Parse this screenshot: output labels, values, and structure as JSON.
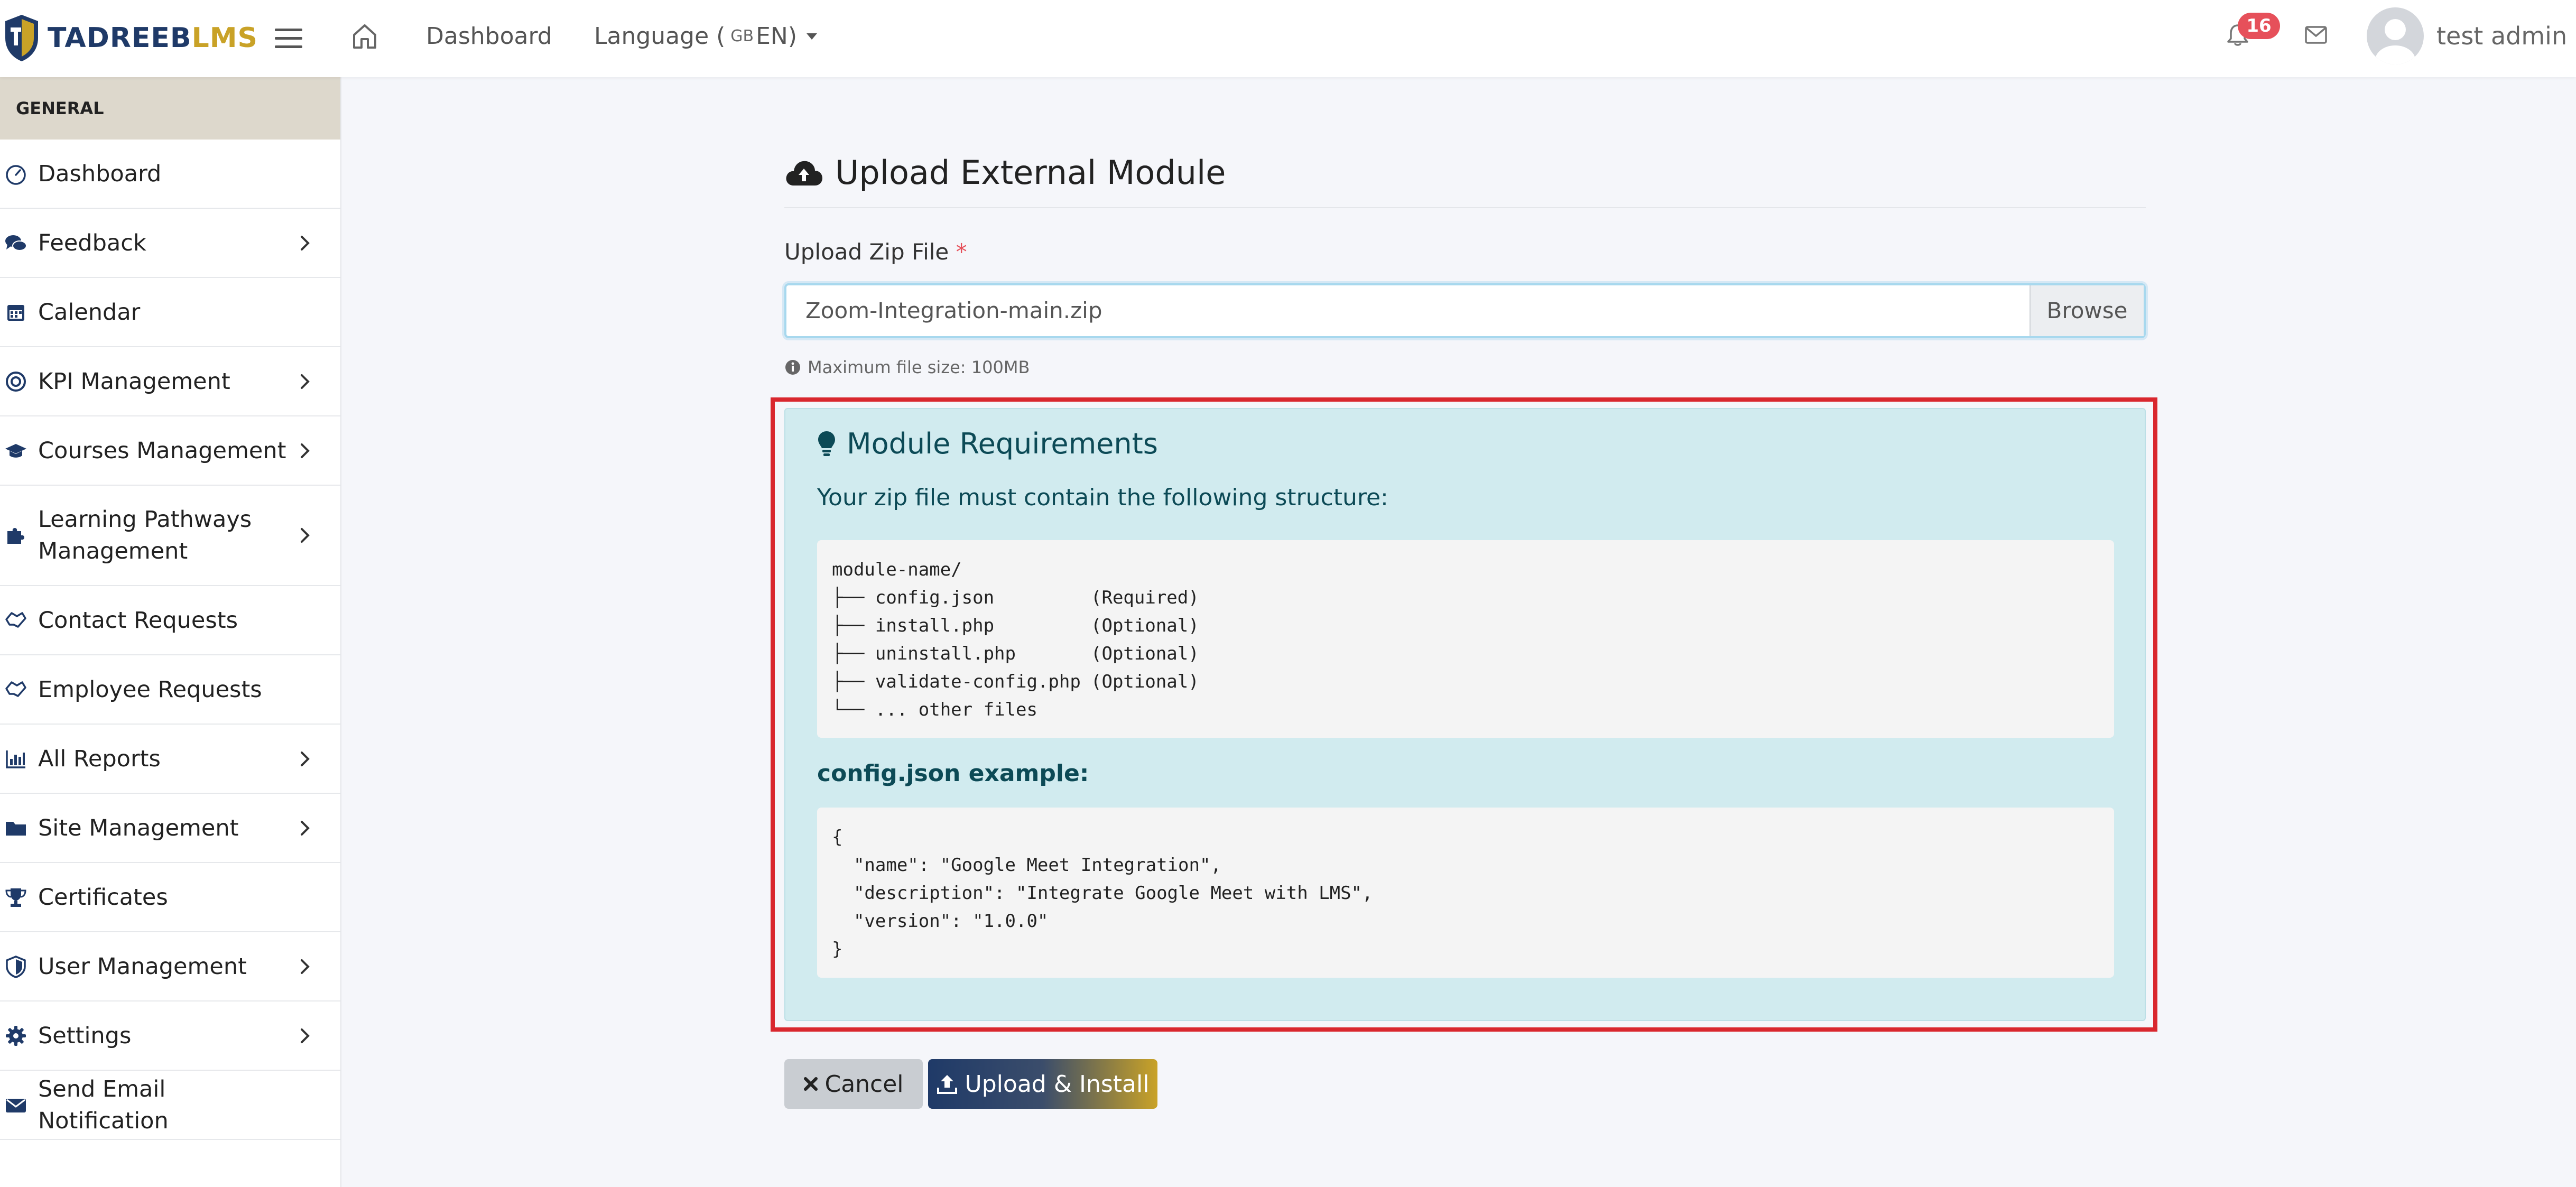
{
  "app": {
    "logo_part1": "TADREEB",
    "logo_part2": "LMS",
    "brand_navy": "#1f3a68",
    "brand_gold": "#c9a227"
  },
  "topbar": {
    "nav_dashboard": "Dashboard",
    "language_label": "Language (",
    "language_flag": "GB",
    "language_code": " EN)",
    "notification_count": "16",
    "user_name": "test admin",
    "icons": [
      "hamburger-menu-icon",
      "home-icon",
      "bell-icon",
      "mail-icon",
      "avatar"
    ]
  },
  "sidebar": {
    "section_label": "GENERAL",
    "items": [
      {
        "label": "Dashboard",
        "icon": "dashboard-gauge-icon",
        "has_submenu": false
      },
      {
        "label": "Feedback",
        "icon": "comments-icon",
        "has_submenu": true
      },
      {
        "label": "Calendar",
        "icon": "calendar-icon",
        "has_submenu": false
      },
      {
        "label": "KPI Management",
        "icon": "target-icon",
        "has_submenu": true
      },
      {
        "label": "Courses Management",
        "icon": "graduation-cap-icon",
        "has_submenu": true
      },
      {
        "label": "Learning Pathways Management",
        "icon": "puzzle-icon",
        "has_submenu": true
      },
      {
        "label": "Contact Requests",
        "icon": "handshake-icon",
        "has_submenu": false
      },
      {
        "label": "Employee Requests",
        "icon": "handshake-icon",
        "has_submenu": false
      },
      {
        "label": "All Reports",
        "icon": "bar-chart-icon",
        "has_submenu": true
      },
      {
        "label": "Site Management",
        "icon": "folder-icon",
        "has_submenu": true
      },
      {
        "label": "Certificates",
        "icon": "trophy-icon",
        "has_submenu": false
      },
      {
        "label": "User Management",
        "icon": "shield-icon",
        "has_submenu": true
      },
      {
        "label": "Settings",
        "icon": "gear-icon",
        "has_submenu": true
      },
      {
        "label": "Send Email Notification",
        "icon": "envelope-icon",
        "has_submenu": false
      }
    ]
  },
  "main": {
    "title": "Upload External Module",
    "upload": {
      "label": "Upload Zip File",
      "required_mark": "*",
      "file_name": "Zoom-Integration-main.zip",
      "browse_label": "Browse",
      "help_text": "Maximum file size: 100MB"
    },
    "requirements": {
      "title": "Module Requirements",
      "description": "Your zip file must contain the following structure:",
      "structure_root": "module-name/",
      "structure": [
        {
          "file": "├── config.json",
          "note": "(Required)"
        },
        {
          "file": "├── install.php",
          "note": "(Optional)"
        },
        {
          "file": "├── uninstall.php",
          "note": "(Optional)"
        },
        {
          "file": "├── validate-config.php",
          "note": "(Optional)"
        },
        {
          "file": "└── ... other files",
          "note": ""
        }
      ],
      "example_title": "config.json example:",
      "example_lines": [
        "{",
        "  \"name\": \"Google Meet Integration\",",
        "  \"description\": \"Integrate Google Meet with LMS\",",
        "  \"version\": \"1.0.0\"",
        "}"
      ]
    },
    "buttons": {
      "cancel": "Cancel",
      "upload": "Upload & Install"
    },
    "colors": {
      "highlight_border": "#d9272e",
      "info_box_bg": "#d1ebef",
      "info_text": "#0c4a56",
      "badge": "#e6505a"
    }
  }
}
